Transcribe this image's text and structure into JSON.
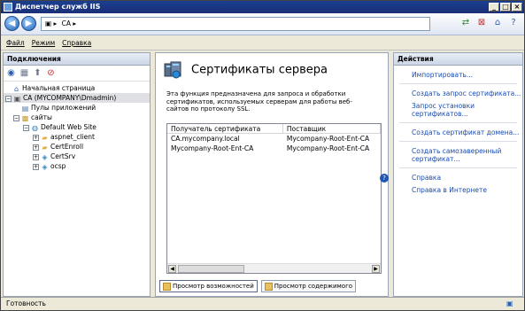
{
  "window": {
    "title": "Диспетчер служб IIS"
  },
  "address": {
    "segments": [
      "CA"
    ]
  },
  "menu": [
    {
      "label": "Файл"
    },
    {
      "label": "Режим"
    },
    {
      "label": "Справка"
    }
  ],
  "left": {
    "header": "Подключения",
    "tree": [
      {
        "label": "Начальная страница",
        "icon": "home-icon"
      },
      {
        "label": "CA (MYCOMPANY\\Dmadmin)",
        "icon": "server-icon",
        "selected": true
      },
      {
        "label": "Пулы приложений",
        "icon": "app-pools-icon"
      },
      {
        "label": "сайты",
        "icon": "sites-icon"
      },
      {
        "label": "Default Web Site",
        "icon": "globe-icon"
      },
      {
        "label": "aspnet_client",
        "icon": "folder-icon"
      },
      {
        "label": "CertEnroll",
        "icon": "folder-icon"
      },
      {
        "label": "CertSrv",
        "icon": "app-icon"
      },
      {
        "label": "ocsp",
        "icon": "app-icon"
      }
    ]
  },
  "center": {
    "title": "Сертификаты сервера",
    "description": "Эта функция предназначена для запроса и обработки сертификатов, используемых серверам для работы веб-сайтов по протоколу SSL.",
    "columns": [
      "Получатель сертификата",
      "Поставщик"
    ],
    "rows": [
      {
        "subject": "CA.mycompany.local",
        "issuer": "Mycompany-Root-Ent-CA"
      },
      {
        "subject": "Mycompany-Root-Ent-CA",
        "issuer": "Mycompany-Root-Ent-CA"
      }
    ],
    "tabs": [
      "Просмотр возможностей",
      "Просмотр содержимого"
    ]
  },
  "right": {
    "header": "Действия",
    "actions": [
      {
        "label": "Импортировать..."
      },
      {
        "label": "Создать запрос сертификата..."
      },
      {
        "label": "Запрос установки сертификатов..."
      },
      {
        "label": "Создать сертификат домена..."
      },
      {
        "label": "Создать самозаверенный сертификат..."
      },
      {
        "label": "Справка"
      },
      {
        "label": "Справка в Интернете"
      }
    ]
  },
  "status": {
    "text": "Готовность"
  }
}
